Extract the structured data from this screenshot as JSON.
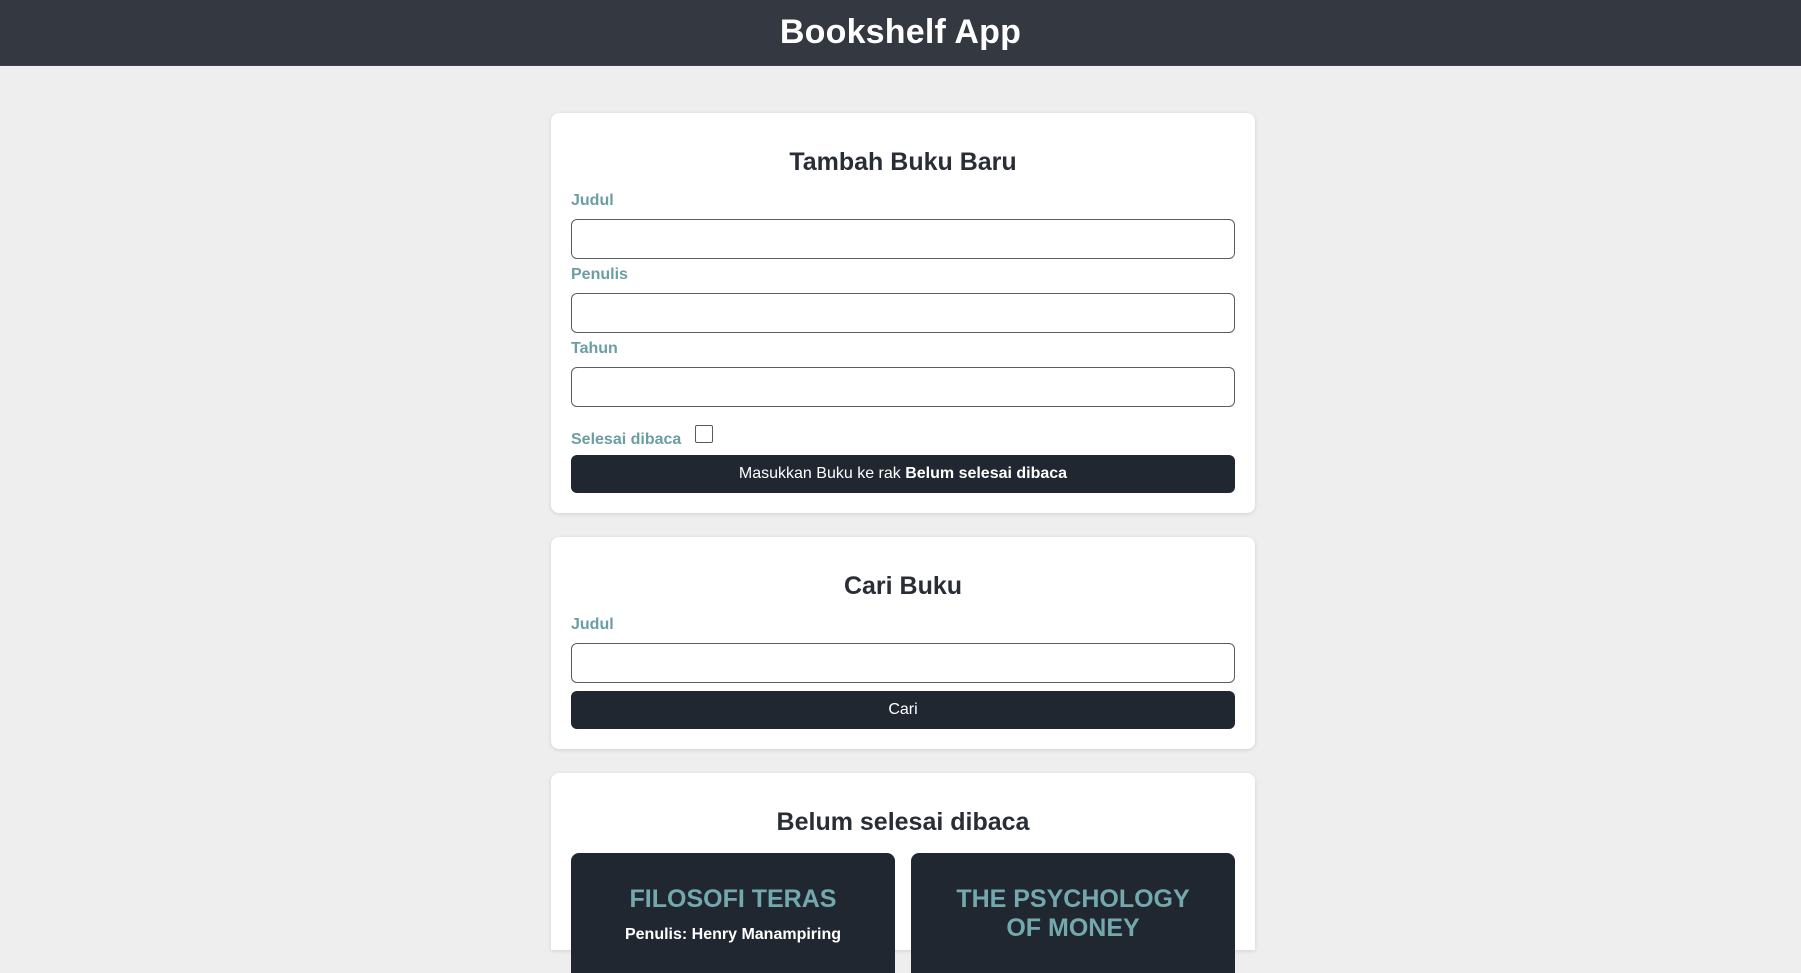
{
  "app": {
    "title": "Bookshelf App"
  },
  "add_form": {
    "title": "Tambah Buku Baru",
    "title_label": "Judul",
    "title_value": "",
    "author_label": "Penulis",
    "author_value": "",
    "year_label": "Tahun",
    "year_value": "",
    "complete_label": "Selesai dibaca",
    "complete_checked": false,
    "submit_prefix": "Masukkan Buku ke rak",
    "submit_target": "Belum selesai dibaca"
  },
  "search_form": {
    "title": "Cari Buku",
    "title_label": "Judul",
    "title_value": "",
    "submit_label": "Cari"
  },
  "incomplete_shelf": {
    "title": "Belum selesai dibaca",
    "books": [
      {
        "title": "FILOSOFI TERAS",
        "author": "Penulis: Henry Manampiring"
      },
      {
        "title": "THE PSYCHOLOGY OF MONEY",
        "author": ""
      }
    ]
  },
  "colors": {
    "header_bg": "#333841",
    "page_bg": "#eeeeee",
    "label_teal": "#6b9ea3",
    "button_dark": "#212730"
  }
}
